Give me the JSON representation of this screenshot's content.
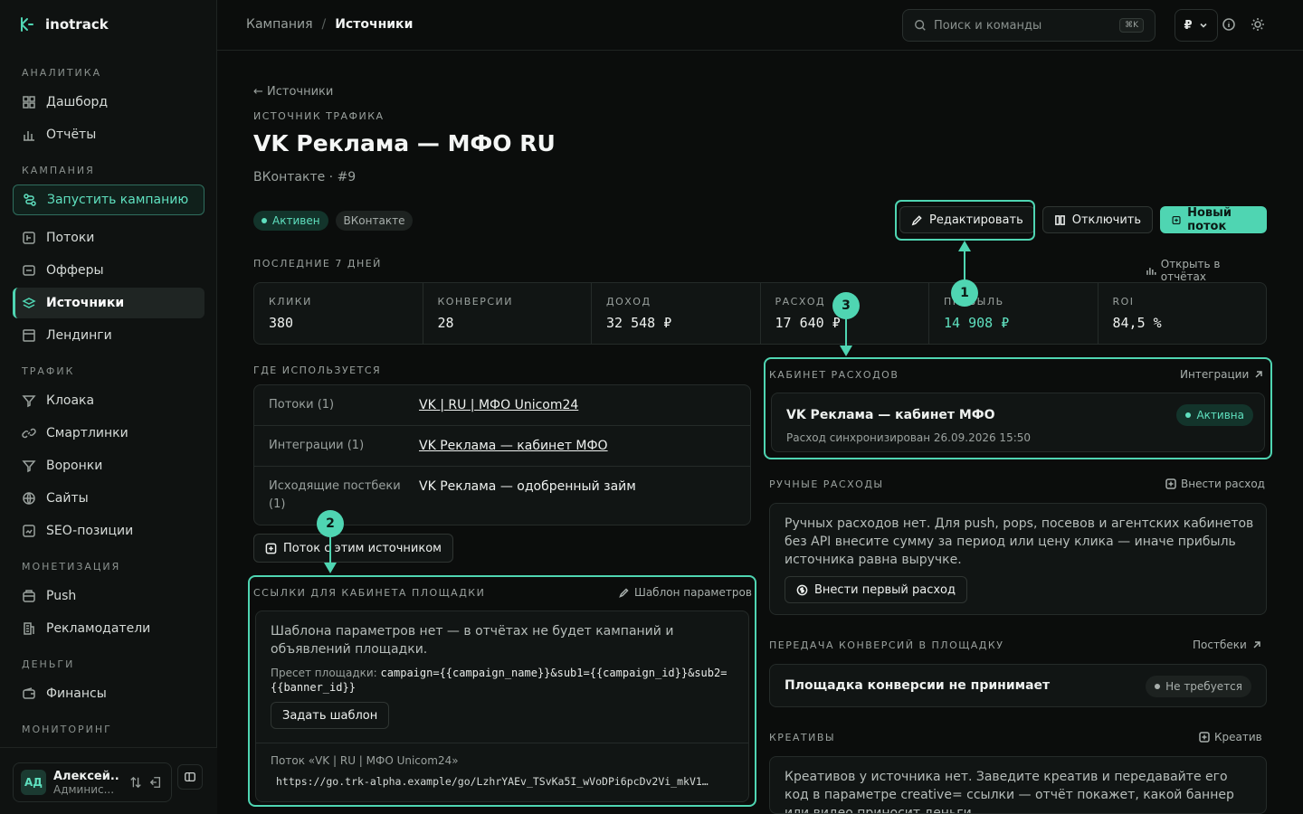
{
  "app": {
    "name": "inotrack"
  },
  "sidebar": {
    "sections": [
      {
        "label": "АНАЛИТИКА"
      },
      {
        "label": "КАМПАНИЯ"
      },
      {
        "label": "ТРАФИК"
      },
      {
        "label": "МОНЕТИЗАЦИЯ"
      },
      {
        "label": "ДЕНЬГИ"
      },
      {
        "label": "МОНИТОРИНГ"
      }
    ],
    "items": {
      "dashboard": "Дашборд",
      "reports": "Отчёты",
      "launch": "Запустить кампанию",
      "flows": "Потоки",
      "offers": "Офферы",
      "sources": "Источники",
      "landings": "Лендинги",
      "cloak": "Клоака",
      "smartlinks": "Смартлинки",
      "funnels": "Воронки",
      "sites": "Сайты",
      "seo": "SEO-позиции",
      "push": "Push",
      "advertisers": "Рекламодатели",
      "finance": "Финансы"
    },
    "user": {
      "initials": "АД",
      "name": "Алексей...",
      "role": "Админис..."
    }
  },
  "topbar": {
    "breadcrumb": [
      "Кампания",
      "Источники"
    ],
    "search_placeholder": "Поиск и команды",
    "search_shortcut": "⌘K",
    "currency": "₽"
  },
  "page": {
    "back": "← Источники",
    "kicker": "ИСТОЧНИК ТРАФИКА",
    "title": "VK Реклама — МФО RU",
    "subtitle": "ВКонтакте · #9",
    "badges": {
      "status": "Активен",
      "network": "ВКонтакте"
    },
    "actions": {
      "edit": "Редактировать",
      "disable": "Отключить",
      "new_flow": "Новый поток"
    }
  },
  "stats": {
    "label": "ПОСЛЕДНИЕ 7 ДНЕЙ",
    "open_reports": "Открыть в отчётах",
    "items": [
      {
        "label": "КЛИКИ",
        "value": "380"
      },
      {
        "label": "КОНВЕРСИИ",
        "value": "28"
      },
      {
        "label": "ДОХОД",
        "value": "32 548 ₽"
      },
      {
        "label": "РАСХОД",
        "value": "17 640 ₽"
      },
      {
        "label": "ПРИБЫЛЬ",
        "value": "14 908 ₽"
      },
      {
        "label": "ROI",
        "value": "84,5 %"
      }
    ]
  },
  "usage": {
    "label": "ГДЕ ИСПОЛЬЗУЕТСЯ",
    "rows": [
      {
        "key": "Потоки (1)",
        "value": "VK | RU | МФО Unicom24"
      },
      {
        "key": "Интеграции (1)",
        "value": "VK Реклама — кабинет МФО"
      },
      {
        "key": "Исходящие постбеки (1)",
        "value": "VK Реклама — одобренный займ"
      }
    ],
    "flow_button": "Поток с этим источником"
  },
  "links": {
    "label": "ССЫЛКИ ДЛЯ КАБИНЕТА ПЛОЩАДКИ",
    "template_link": "Шаблон параметров",
    "empty_note": "Шаблона параметров нет — в отчётах не будет кампаний и объявлений площадки.",
    "preset_label": "Пресет площадки:",
    "preset_value": "campaign={{campaign_name}}&sub1={{campaign_id}}&sub2={{banner_id}}",
    "set_template": "Задать шаблон",
    "flow_label": "Поток «VK | RU | МФО Unicom24»",
    "flow_url": "https://go.trk-alpha.example/go/LzhrYAEv_TSvKa5I_wVoDPi6pcDv2Vi_mkV1…"
  },
  "cabinet": {
    "label": "КАБИНЕТ РАСХОДОВ",
    "integrations": "Интеграции",
    "name": "VK Реклама — кабинет МФО",
    "sync": "Расход синхронизирован 26.09.2026 15:50",
    "status": "Активна"
  },
  "manual": {
    "label": "РУЧНЫЕ РАСХОДЫ",
    "add": "Внести расход",
    "note": "Ручных расходов нет. Для push, pops, посевов и агентских кабинетов без API внесите сумму за период или цену клика — иначе прибыль источника равна выручке.",
    "first": "Внести первый расход"
  },
  "conversions": {
    "label": "ПЕРЕДАЧА КОНВЕРСИЙ В ПЛОЩАДКУ",
    "postbacks": "Постбеки",
    "text": "Площадка конверсии не принимает",
    "status": "Не требуется"
  },
  "creatives": {
    "label": "КРЕАТИВЫ",
    "add": "Креатив",
    "note": "Креативов у источника нет. Заведите креатив и передавайте его код в параметре creative= ссылки — отчёт покажет, какой баннер или видео приносит деньги."
  },
  "annotations": [
    "1",
    "2",
    "3"
  ],
  "colors": {
    "accent": "#4fd5b2",
    "bg": "#0b0d0c",
    "panel": "#111514"
  }
}
